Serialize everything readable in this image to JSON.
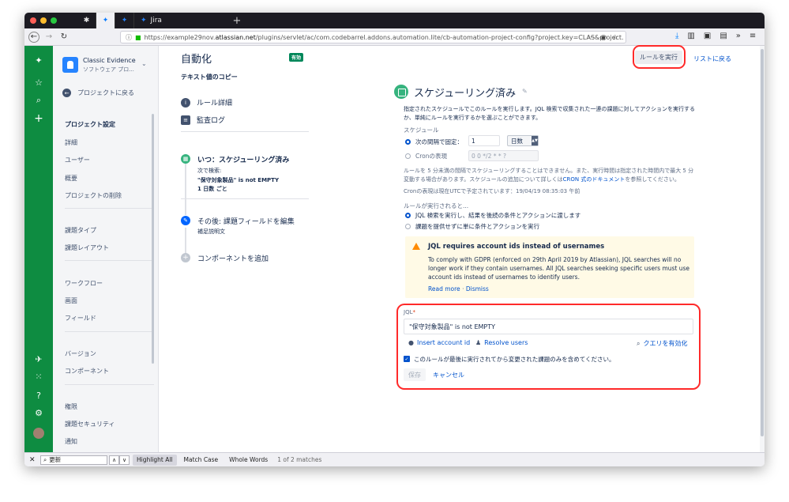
{
  "browser": {
    "tab_jira_label": "Jira",
    "url_prefix": "https://example29nov.",
    "url_domain": "atlassian.net",
    "url_rest": "/plugins/servlet/ac/com.codebarrel.addons.automation.lite/cb-automation-project-config?project.key=CLAS&project."
  },
  "project": {
    "name": "Classic Evidence",
    "type": "ソフトウェア プロ...",
    "back_label": "プロジェクトに戻る"
  },
  "sidebar": {
    "settings_heading": "プロジェクト設定",
    "group1": [
      "詳細",
      "ユーザー",
      "概要",
      "プロジェクトの削除"
    ],
    "group2": [
      "課題タイプ",
      "課題レイアウト"
    ],
    "group3": [
      "ワークフロー",
      "画面",
      "フィールド"
    ],
    "group4": [
      "バージョン",
      "コンポーネント"
    ],
    "group5": [
      "権限",
      "課題セキュリティ",
      "通知"
    ]
  },
  "automation": {
    "page_title": "自動化",
    "status_badge": "有効",
    "rule_name": "テキスト値のコピー",
    "nav_rule_details": "ルール詳細",
    "nav_audit_log": "監査ログ",
    "run_rule_button": "ルールを実行",
    "back_to_list": "リストに戻る"
  },
  "flow": {
    "trigger_title": "いつ：スケジューリング済み",
    "trigger_sub1": "次で検索:",
    "trigger_sub2": "\"保守対象製品\" is not EMPTY",
    "trigger_sub3": "1 日数 ごと",
    "action_title": "その後: 課題フィールドを編集",
    "action_sub": "補足説明文",
    "add_component": "コンポーネントを追加"
  },
  "trigger_config": {
    "title": "スケジューリング済み",
    "description": "指定されたスケジュールでこのルールを実行します。JQL 検索で収集された一連の課題に対してアクションを実行するか、単純にルールを実行するかを選ぶことができます。",
    "schedule_label": "スケジュール",
    "radio_interval": "次の間隔で固定：",
    "interval_value": "1",
    "interval_unit": "日数",
    "radio_cron": "Cronの表現",
    "cron_placeholder": "0 0 */2 * * ?",
    "note_part1": "ルールを 5 分未満の間隔でスケジューリングすることはできません。また、実行時間は指定された時間内で最大 5 分変動する場合があります。スケジュールの追加について詳しくは",
    "note_link": "CRON 式のドキュメント",
    "note_part2": "を参照してください。",
    "next_run": "Cronの表現は現在UTCで予定されています：19/04/19 08:35:03 午前",
    "when_runs_label": "ルールが実行されると...",
    "radio_jql": "JQL 検索を実行し、結果を後続の条件とアクションに渡します",
    "radio_no_issue": "課題を提供せずに単に条件とアクションを実行"
  },
  "warning": {
    "title": "JQL requires account ids instead of usernames",
    "body": "To comply with GDPR (enforced on 29th April 2019 by Atlassian), JQL searches will no longer work if they contain usernames. All JQL searches seeking specific users must use account ids instead of usernames to identify users.",
    "read_more": "Read more",
    "separator": "·",
    "dismiss": "Dismiss"
  },
  "jql": {
    "label": "JQL",
    "required_mark": "*",
    "value": "\"保守対象製品\" is not EMPTY",
    "insert_account_id": "Insert account id",
    "resolve_users": "Resolve users",
    "validate_query": "クエリを有効化",
    "checkbox_label": "このルールが最後に実行されてから変更された課題のみを含めてください。",
    "save_button": "保存",
    "cancel_button": "キャンセル"
  },
  "findbar": {
    "query": "更新",
    "highlight_all": "Highlight All",
    "match_case": "Match Case",
    "whole_words": "Whole Words",
    "match_count": "1 of 2 matches"
  },
  "colors": {
    "jira_green": "#0e8c41",
    "link_blue": "#0052cc",
    "highlight_red": "#ff2a2a",
    "warning_bg": "#fffae6"
  }
}
